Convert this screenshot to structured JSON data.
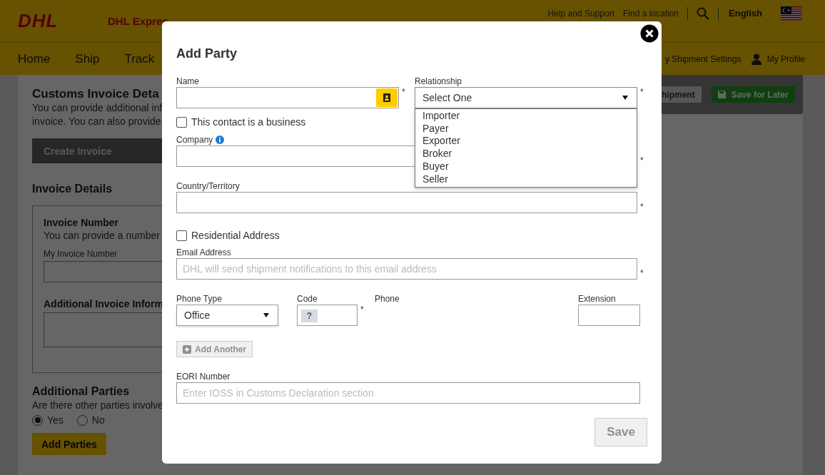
{
  "header": {
    "logo": "DHL",
    "brand": "DHL Expres",
    "links": [
      "Help and Support",
      "Find a location"
    ],
    "language": "English"
  },
  "nav": {
    "items": [
      "Home",
      "Ship",
      "Track"
    ],
    "right_items": [
      "y Shipment Settings",
      "My Profile"
    ]
  },
  "page": {
    "title": "Customs Invoice Deta",
    "intro_lines": [
      "You can provide additional inf",
      "invoice. You can also provide"
    ],
    "create_button": "Create Invoice",
    "invoice_details_heading": "Invoice Details",
    "invoice_number": {
      "title": "Invoice Number",
      "text": "You can provide a number",
      "field_label": "My Invoice Number"
    },
    "additional_info_label": "Additional Invoice Inform",
    "parties": {
      "title": "Additional Parties",
      "question": "Are there other parties involve",
      "options": [
        {
          "label": "Yes",
          "selected": true
        },
        {
          "label": "No",
          "selected": false
        }
      ],
      "button": "Add Parties"
    }
  },
  "action_bar": {
    "buttons": [
      {
        "label": "hipment",
        "kind": "secondary"
      },
      {
        "label": "Save for Later",
        "kind": "save"
      }
    ]
  },
  "modal": {
    "title": "Add Party",
    "name": {
      "label": "Name",
      "asterisk": "*"
    },
    "relationship": {
      "label": "Relationship",
      "value": "Select One",
      "asterisk": "*",
      "expanded": true,
      "options": [
        {
          "label": "Importer",
          "selected": false
        },
        {
          "label": "Payer",
          "selected": false
        },
        {
          "label": "Exporter",
          "selected": false
        },
        {
          "label": "Broker",
          "selected": false
        },
        {
          "label": "Buyer",
          "selected": false
        },
        {
          "label": "Seller",
          "selected": false
        }
      ]
    },
    "business_checkbox": {
      "label": "This contact is a business",
      "checked": false
    },
    "company": {
      "label": "Company",
      "asterisk": "*"
    },
    "country": {
      "label": "Country/Territory",
      "asterisk": "*"
    },
    "residential_checkbox": {
      "label": "Residential Address",
      "checked": false
    },
    "email": {
      "label": "Email Address",
      "placeholder": "DHL will send shipment notifications to this email address",
      "asterisk": "*"
    },
    "phone": {
      "type_label": "Phone Type",
      "type_value": "Office",
      "code_label": "Code",
      "code_hint": "?",
      "asterisk": "*",
      "phone_label": "Phone",
      "extension_label": "Extension"
    },
    "add_another": {
      "label": "Add Another",
      "disabled": true
    },
    "eori": {
      "label": "EORI Number",
      "placeholder": "Enter IOSS in Customs Declaration section"
    },
    "save": {
      "label": "Save",
      "disabled": true
    }
  }
}
